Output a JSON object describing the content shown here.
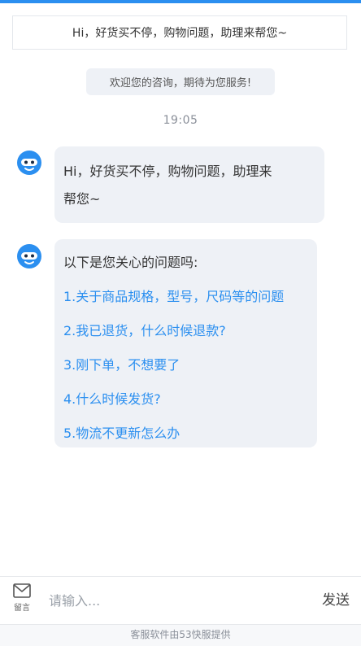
{
  "notice": "Hi，好货买不停，购物问题，助理来帮您~",
  "welcome": "欢迎您的咨询，期待为您服务!",
  "time": "19:05",
  "messages": [
    {
      "sender_icon": "robot-avatar-icon",
      "text_line1": "Hi，好货买不停，购物问题，助理来",
      "text_line2": "帮您~"
    },
    {
      "sender_icon": "robot-avatar-icon",
      "title": "以下是您关心的问题吗:",
      "questions": [
        "1.关于商品规格，型号，尺码等的问题",
        "2.我已退货，什么时候退款?",
        "3.刚下单，不想要了",
        "4.什么时候发货?",
        "5.物流不更新怎么办"
      ]
    }
  ],
  "input_bar": {
    "leave_message_icon": "envelope-icon",
    "leave_message_label": "留言",
    "placeholder": "请输入...",
    "send_label": "发送"
  },
  "footer": "客服软件由53快服提供",
  "colors": {
    "accent": "#2b8ff0",
    "bubble_bg": "#eef1f6",
    "link": "#2b8ff0"
  }
}
